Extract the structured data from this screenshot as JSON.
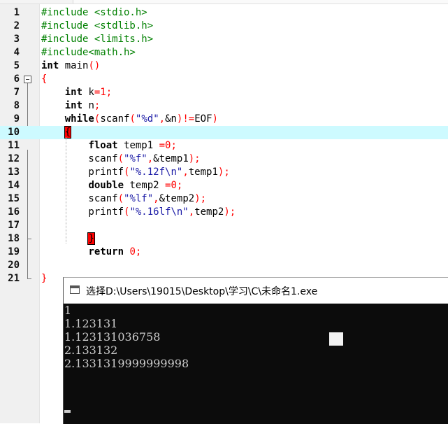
{
  "editor": {
    "lines": [
      {
        "n": "1",
        "tokens": [
          {
            "t": "pp",
            "v": "#include <stdio.h>"
          }
        ]
      },
      {
        "n": "2",
        "tokens": [
          {
            "t": "pp",
            "v": "#include <stdlib.h>"
          }
        ]
      },
      {
        "n": "3",
        "tokens": [
          {
            "t": "pp",
            "v": "#include <limits.h>"
          }
        ]
      },
      {
        "n": "4",
        "tokens": [
          {
            "t": "pp",
            "v": "#include<math.h>"
          }
        ]
      },
      {
        "n": "5",
        "tokens": [
          {
            "t": "kw",
            "v": "int"
          },
          {
            "t": "",
            "v": " main"
          },
          {
            "t": "op",
            "v": "()"
          }
        ]
      },
      {
        "n": "6",
        "tokens": [
          {
            "t": "op",
            "v": "{"
          }
        ]
      },
      {
        "n": "7",
        "tokens": [
          {
            "t": "",
            "v": "    "
          },
          {
            "t": "kw",
            "v": "int"
          },
          {
            "t": "",
            "v": " k"
          },
          {
            "t": "op",
            "v": "="
          },
          {
            "t": "num",
            "v": "1"
          },
          {
            "t": "op",
            "v": ";"
          }
        ]
      },
      {
        "n": "8",
        "tokens": [
          {
            "t": "",
            "v": "    "
          },
          {
            "t": "kw",
            "v": "int"
          },
          {
            "t": "",
            "v": " n"
          },
          {
            "t": "op",
            "v": ";"
          }
        ]
      },
      {
        "n": "9",
        "tokens": [
          {
            "t": "",
            "v": "    "
          },
          {
            "t": "kw",
            "v": "while"
          },
          {
            "t": "op",
            "v": "("
          },
          {
            "t": "",
            "v": "scanf"
          },
          {
            "t": "op",
            "v": "("
          },
          {
            "t": "str",
            "v": "\"%d\""
          },
          {
            "t": "op",
            "v": ","
          },
          {
            "t": "",
            "v": "&n"
          },
          {
            "t": "op",
            "v": ")!="
          },
          {
            "t": "",
            "v": "EOF"
          },
          {
            "t": "op",
            "v": ")"
          }
        ]
      },
      {
        "n": "10",
        "active": true,
        "tokens": [
          {
            "t": "",
            "v": "    "
          },
          {
            "t": "brace",
            "v": "{"
          }
        ]
      },
      {
        "n": "11",
        "tokens": [
          {
            "t": "",
            "v": "        "
          },
          {
            "t": "kw",
            "v": "float"
          },
          {
            "t": "",
            "v": " temp1 "
          },
          {
            "t": "op",
            "v": "="
          },
          {
            "t": "num",
            "v": "0"
          },
          {
            "t": "op",
            "v": ";"
          }
        ]
      },
      {
        "n": "12",
        "tokens": [
          {
            "t": "",
            "v": "        scanf"
          },
          {
            "t": "op",
            "v": "("
          },
          {
            "t": "str",
            "v": "\"%f\""
          },
          {
            "t": "op",
            "v": ","
          },
          {
            "t": "",
            "v": "&temp1"
          },
          {
            "t": "op",
            "v": ");"
          }
        ]
      },
      {
        "n": "13",
        "tokens": [
          {
            "t": "",
            "v": "        printf"
          },
          {
            "t": "op",
            "v": "("
          },
          {
            "t": "str",
            "v": "\"%.12f\\n\""
          },
          {
            "t": "op",
            "v": ","
          },
          {
            "t": "",
            "v": "temp1"
          },
          {
            "t": "op",
            "v": ");"
          }
        ]
      },
      {
        "n": "14",
        "tokens": [
          {
            "t": "",
            "v": "        "
          },
          {
            "t": "kw",
            "v": "double"
          },
          {
            "t": "",
            "v": " temp2 "
          },
          {
            "t": "op",
            "v": "="
          },
          {
            "t": "num",
            "v": "0"
          },
          {
            "t": "op",
            "v": ";"
          }
        ]
      },
      {
        "n": "15",
        "tokens": [
          {
            "t": "",
            "v": "        scanf"
          },
          {
            "t": "op",
            "v": "("
          },
          {
            "t": "str",
            "v": "\"%lf\""
          },
          {
            "t": "op",
            "v": ","
          },
          {
            "t": "",
            "v": "&temp2"
          },
          {
            "t": "op",
            "v": ");"
          }
        ]
      },
      {
        "n": "16",
        "tokens": [
          {
            "t": "",
            "v": "        printf"
          },
          {
            "t": "op",
            "v": "("
          },
          {
            "t": "str",
            "v": "\"%.16lf\\n\""
          },
          {
            "t": "op",
            "v": ","
          },
          {
            "t": "",
            "v": "temp2"
          },
          {
            "t": "op",
            "v": ");"
          }
        ]
      },
      {
        "n": "17",
        "tokens": []
      },
      {
        "n": "18",
        "tokens": [
          {
            "t": "",
            "v": "        "
          },
          {
            "t": "brace",
            "v": "}"
          }
        ]
      },
      {
        "n": "19",
        "tokens": [
          {
            "t": "",
            "v": "        "
          },
          {
            "t": "kw",
            "v": "return"
          },
          {
            "t": "",
            "v": " "
          },
          {
            "t": "num",
            "v": "0"
          },
          {
            "t": "op",
            "v": ";"
          }
        ]
      },
      {
        "n": "20",
        "tokens": []
      },
      {
        "n": "21",
        "tokens": [
          {
            "t": "op",
            "v": "}"
          }
        ]
      }
    ]
  },
  "console": {
    "title": "选择D:\\Users\\19015\\Desktop\\学习\\C\\未命名1.exe",
    "output": [
      "1",
      "1.123131",
      "1.123131036758",
      "2.133132",
      "2.1331319999999998"
    ]
  },
  "colors": {
    "active_line": "#cdfaff",
    "preprocessor": "#008000",
    "keyword": "#000000",
    "string": "#1a1aa6",
    "operator": "#ff0000",
    "console_bg": "#0c0c0c",
    "console_fg": "#cccccc"
  }
}
